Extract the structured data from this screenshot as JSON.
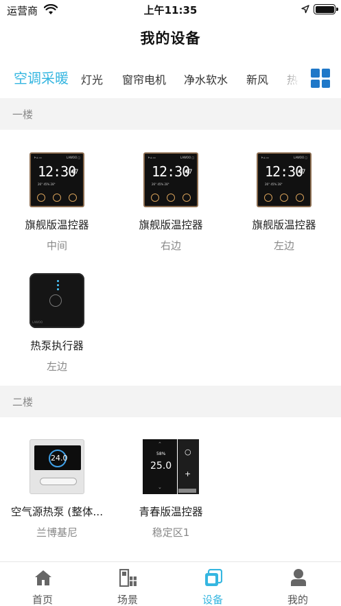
{
  "status_bar": {
    "carrier": "运营商",
    "time": "上午11:35"
  },
  "page_title": "我的设备",
  "tabs": [
    {
      "label": "空调采暖",
      "active": true
    },
    {
      "label": "灯光",
      "active": false
    },
    {
      "label": "窗帘电机",
      "active": false
    },
    {
      "label": "净水软水",
      "active": false
    },
    {
      "label": "新风",
      "active": false
    },
    {
      "label": "热",
      "active": false
    }
  ],
  "sections": [
    {
      "title": "一楼",
      "devices": [
        {
          "name": "旗舰版温控器",
          "location": "中间",
          "icon": "flagship-thermostat"
        },
        {
          "name": "旗舰版温控器",
          "location": "右边",
          "icon": "flagship-thermostat"
        },
        {
          "name": "旗舰版温控器",
          "location": "左边",
          "icon": "flagship-thermostat"
        },
        {
          "name": "热泵执行器",
          "location": "左边",
          "icon": "heat-pump-actuator"
        }
      ]
    },
    {
      "title": "二楼",
      "devices": [
        {
          "name": "空气源热泵 (整体...",
          "location": "兰博基尼",
          "icon": "air-source-heat-pump"
        },
        {
          "name": "青春版温控器",
          "location": "稳定区1",
          "icon": "youth-thermostat"
        }
      ]
    }
  ],
  "device_screens": {
    "flagship_clock": "12:30",
    "flagship_seconds": "47",
    "heat_pump_temp": "24.0",
    "youth_temp": "25.0",
    "youth_humidity": "58%"
  },
  "bottom_nav": [
    {
      "label": "首页",
      "icon": "home-icon",
      "active": false
    },
    {
      "label": "场景",
      "icon": "scene-icon",
      "active": false
    },
    {
      "label": "设备",
      "icon": "device-icon",
      "active": true
    },
    {
      "label": "我的",
      "icon": "profile-icon",
      "active": false
    }
  ],
  "colors": {
    "accent": "#35b6e0",
    "grid_button": "#1f78c8",
    "section_bg": "#f3f3f3"
  }
}
